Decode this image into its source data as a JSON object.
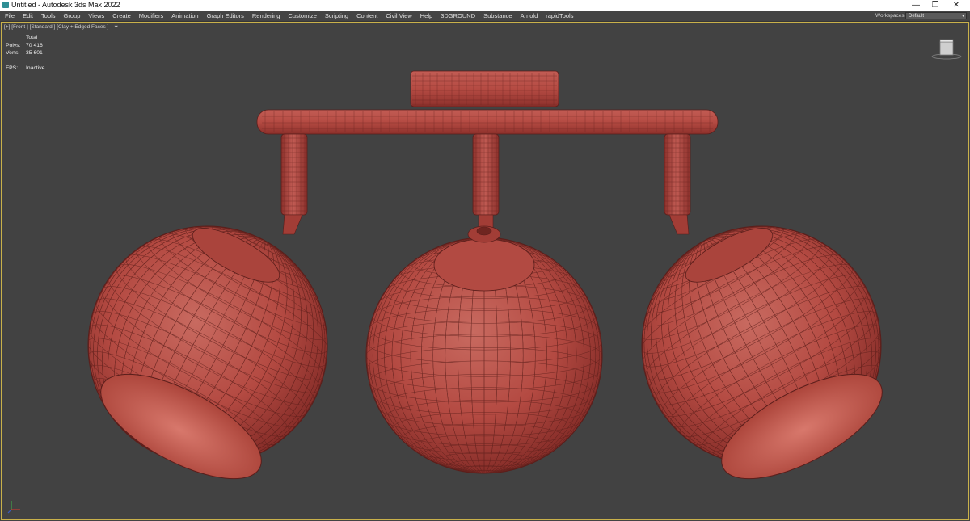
{
  "titlebar": {
    "title": "Untitled - Autodesk 3ds Max 2022",
    "minimize": "—",
    "restore": "❐",
    "close": "✕"
  },
  "menu": {
    "items": [
      "File",
      "Edit",
      "Tools",
      "Group",
      "Views",
      "Create",
      "Modifiers",
      "Animation",
      "Graph Editors",
      "Rendering",
      "Customize",
      "Scripting",
      "Content",
      "Civil View",
      "Help",
      "3DGROUND",
      "Substance",
      "Arnold",
      "rapidTools"
    ],
    "workspaces_label": "Workspaces:",
    "workspace_value": "Default"
  },
  "viewport": {
    "label": "[+] [Front ] [Standard ] [Clay + Edged Faces ]",
    "stats": {
      "total_label": "Total",
      "polys_label": "Polys:",
      "polys_value": "70 416",
      "verts_label": "Verts:",
      "verts_value": "35 601",
      "fps_label": "FPS:",
      "fps_value": "Inactive"
    },
    "view_cube": "view-cube",
    "filter_icon": "funnel-icon"
  },
  "colors": {
    "clay": "#b34a43",
    "wire": "#5a1e1b",
    "background": "#424242",
    "viewport_border": "#c9b14a"
  }
}
